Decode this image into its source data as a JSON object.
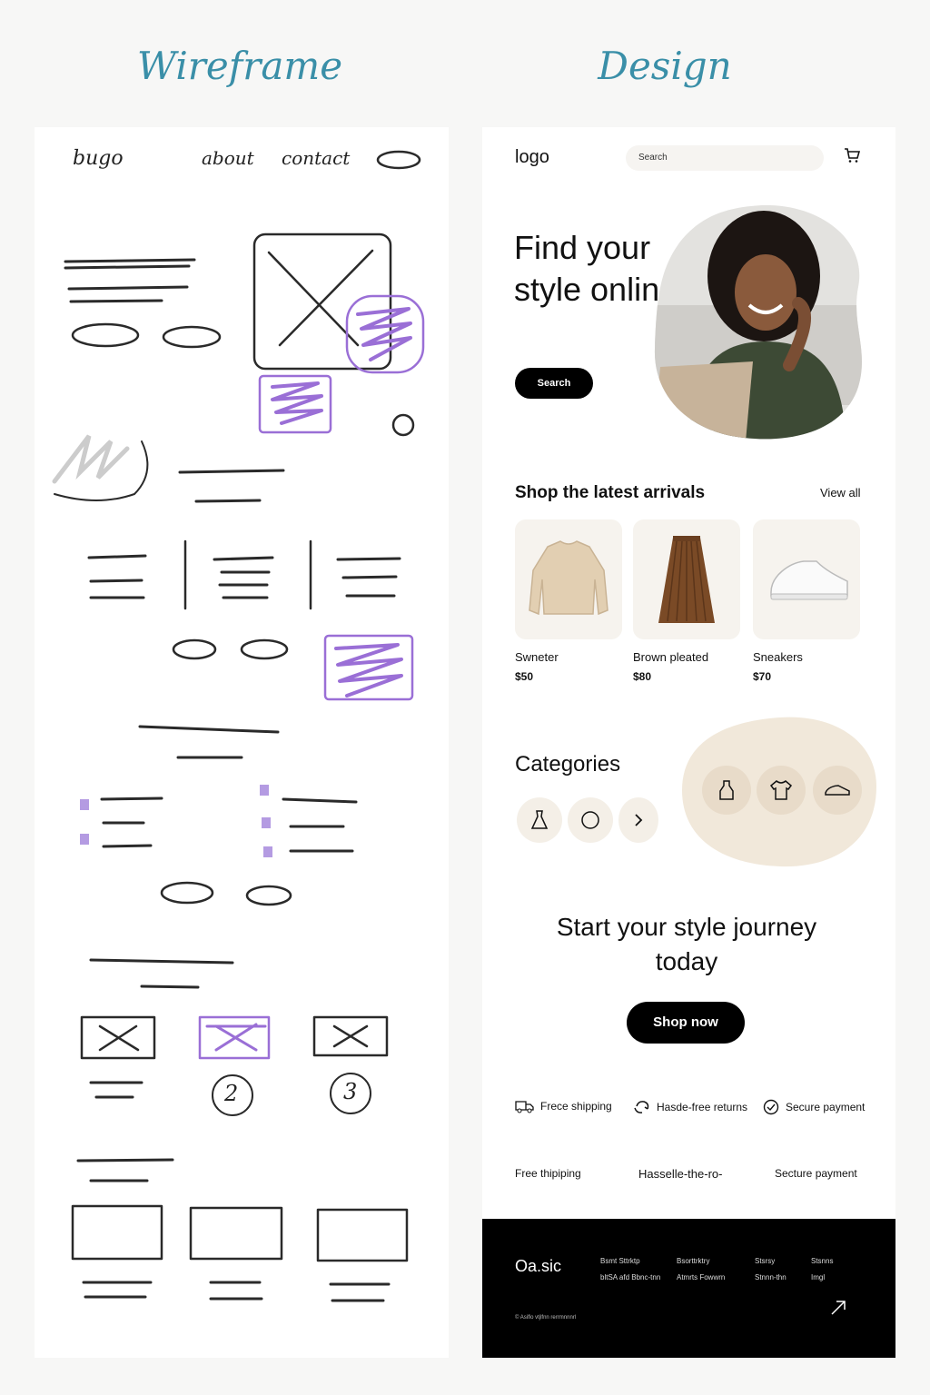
{
  "headings": {
    "wireframe": "Wireframe",
    "design": "Design"
  },
  "wireframe": {
    "nav": {
      "logo": "bugo",
      "about": "about",
      "contact": "contact"
    },
    "numbers": [
      "2",
      "3"
    ]
  },
  "design": {
    "header": {
      "logo": "logo",
      "search_placeholder": "Search"
    },
    "hero": {
      "title": "Find your style online",
      "button": "Search"
    },
    "arrivals": {
      "title": "Shop the latest arrivals",
      "view_all": "View all",
      "products": [
        {
          "name": "Swneter",
          "price": "$50"
        },
        {
          "name": "Brown pleated",
          "price": "$80"
        },
        {
          "name": "Sneakers",
          "price": "$70"
        }
      ]
    },
    "categories": {
      "title": "Categories"
    },
    "cta": {
      "title": "Start your style journey today",
      "button": "Shop now"
    },
    "features": [
      "Frece shipping",
      "Hasde-free returns",
      "Secure payment"
    ],
    "features2": [
      "Free thipiping",
      "Hasselle-the-ro-",
      "Secture payment"
    ],
    "footer": {
      "brand": "Oa.sic",
      "cols": [
        [
          "Bsmt Sttrktp",
          "bltSA afd Bbnc-tnn"
        ],
        [
          "Bsorttrktry",
          "Atmrts Fowwrn"
        ],
        [
          "Stsrsy",
          "Stnnn-thn"
        ],
        [
          "Stsnns",
          "Imgl"
        ]
      ],
      "copyright": "© Asiflo vtjlfnn rerrmnnnrl"
    },
    "colors": {
      "accent": "#000000",
      "beige": "#f1e8da",
      "heading": "#3a8fa8"
    }
  }
}
